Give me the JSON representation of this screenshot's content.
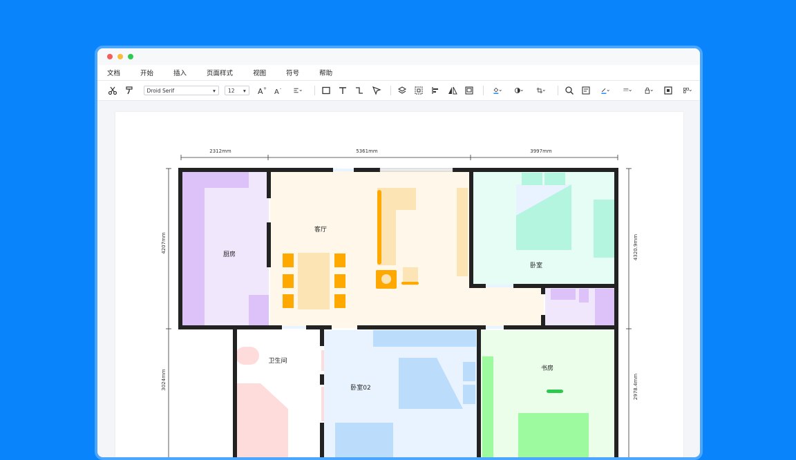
{
  "window": {
    "dots": [
      "#f35d5b",
      "#f6bd3b",
      "#2fca4f"
    ]
  },
  "menu": [
    "文档",
    "开始",
    "插入",
    "页面样式",
    "视图",
    "符号",
    "帮助"
  ],
  "toolbar": {
    "font_family": "Droid Serif",
    "font_size": "12",
    "icons": [
      "cut-icon",
      "format-painter-icon",
      "font-increase-icon",
      "font-decrease-icon",
      "align-icon",
      "rectangle-icon",
      "text-icon",
      "connector-icon",
      "pointer-icon",
      "layers-icon",
      "group-icon",
      "align-left-icon",
      "flip-icon",
      "frame-icon",
      "fill-color-icon",
      "shape-style-icon",
      "crop-icon",
      "search-icon",
      "page-icon",
      "line-color-icon",
      "line-style-icon",
      "lock-icon",
      "fit-icon",
      "more-icon"
    ]
  },
  "floorplan": {
    "rooms": {
      "kitchen": "厨房",
      "living": "客厅",
      "bedroom": "卧室",
      "bathroom": "卫生间",
      "bedroom02": "卧室02",
      "study": "书房"
    },
    "dimensions": {
      "top1": "2312mm",
      "top2": "5361mm",
      "top3": "3997mm",
      "left1": "4207mm",
      "left2": "3024mm",
      "right1": "4320.9mm",
      "right2": "2978.4mm"
    },
    "colors": {
      "wall": "#222222",
      "kitchen": "#f1e7fd",
      "kitchen_accent": "#dcc2f8",
      "living": "#fff7ea",
      "furniture_orange": "#ffa800",
      "furniture_beige": "#fde4b4",
      "bedroom": "#e6fdf5",
      "bedroom_accent": "#b3f5df",
      "bathroom": "#ffffff",
      "bathroom_accent": "#ffdcdc",
      "bedroom02": "#e9f3ff",
      "bedroom02_accent": "#bcdcfb",
      "study": "#eafeea",
      "study_accent": "#9efa9e"
    }
  }
}
